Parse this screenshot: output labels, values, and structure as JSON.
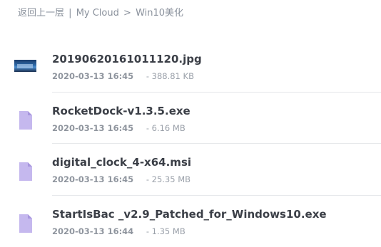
{
  "breadcrumb": {
    "back": "返回上一层",
    "sep1": "|",
    "root": "My Cloud",
    "sep2": ">",
    "current": "Win10美化"
  },
  "files": [
    {
      "name": "20190620161011120.jpg",
      "date": "2020-03-13 16:45",
      "size": "- 388.81 KB",
      "icon": "image-thumbnail"
    },
    {
      "name": "RocketDock-v1.3.5.exe",
      "date": "2020-03-13 16:45",
      "size": "- 6.16 MB",
      "icon": "file-icon"
    },
    {
      "name": "digital_clock_4-x64.msi",
      "date": "2020-03-13 16:45",
      "size": "- 25.35 MB",
      "icon": "file-icon"
    },
    {
      "name": "StartIsBac _v2.9_Patched_for_Windows10.exe",
      "date": "2020-03-13 16:44",
      "size": "- 1.35 MB",
      "icon": "file-icon"
    }
  ],
  "colors": {
    "file_icon": "#c5b8ee",
    "file_icon_fold": "#a796de"
  }
}
